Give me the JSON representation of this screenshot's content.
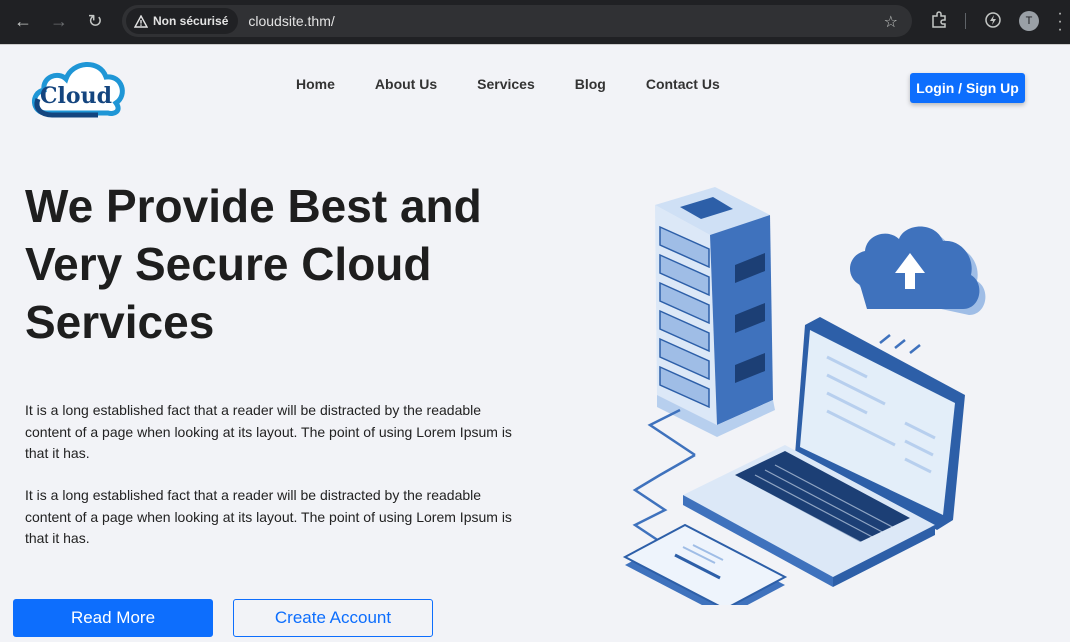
{
  "browser": {
    "security_label": "Non sécurisé",
    "url": "cloudsite.thm/",
    "avatar_letter": "T",
    "icons": [
      "back-icon",
      "forward-icon",
      "reload-icon",
      "warning-icon",
      "star-icon",
      "extensions-icon",
      "performance-icon",
      "menu-icon"
    ]
  },
  "site": {
    "logo_text": "Cloud",
    "nav": [
      {
        "label": "Home"
      },
      {
        "label": "About Us"
      },
      {
        "label": "Services"
      },
      {
        "label": "Blog"
      },
      {
        "label": "Contact Us"
      }
    ],
    "login_label": "Login / Sign Up",
    "hero": {
      "title_line1": "We Provide Best and",
      "title_line2": "Very Secure Cloud",
      "title_line3": "Services",
      "paragraph1": "It is a long established fact that a reader will be distracted by the readable content of a page when looking at its layout. The point of using Lorem Ipsum is that it has.",
      "paragraph2": "It is a long established fact that a reader will be distracted by the readable content of a page when looking at its layout. The point of using Lorem Ipsum is that it has.",
      "read_more_label": "Read More",
      "create_account_label": "Create Account"
    },
    "colors": {
      "primary": "#0d6efd",
      "illustration_dark": "#2d5fa8",
      "illustration_light": "#cfe0f5"
    }
  }
}
